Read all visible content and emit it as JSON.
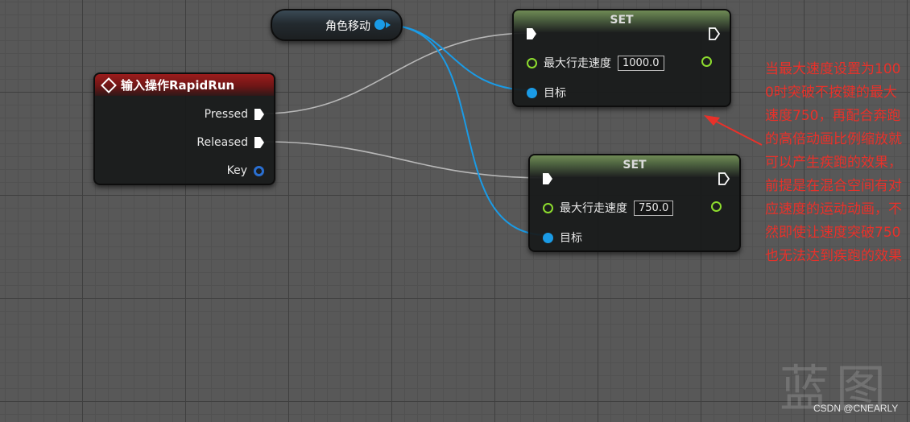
{
  "variable_node": {
    "label": "角色移动"
  },
  "event_node": {
    "title": "输入操作RapidRun",
    "pins": {
      "pressed": "Pressed",
      "released": "Released",
      "key": "Key"
    }
  },
  "set_node_1": {
    "title": "SET",
    "property_label": "最大行走速度",
    "value": "1000.0",
    "target_label": "目标"
  },
  "set_node_2": {
    "title": "SET",
    "property_label": "最大行走速度",
    "value": "750.0",
    "target_label": "目标"
  },
  "annotation": {
    "text": "当最大速度设置为1000时突破不按键的最大速度750，再配合奔跑的高倍动画比例缩放就可以产生疾跑的效果，前提是在混合空间有对应速度的运动动画，不然即使让速度突破750也无法达到疾跑的效果"
  },
  "watermark": {
    "text": "蓝图"
  },
  "credit": {
    "text": "CSDN @CNEARLY"
  },
  "colors": {
    "exec_wire": "#c8c8c8",
    "object_wire": "#1a9be6",
    "float_pin": "#8ddc2e",
    "event_header": "#8b1a1a",
    "set_header": "#6f8a55",
    "annotation_text": "#e8312a"
  }
}
